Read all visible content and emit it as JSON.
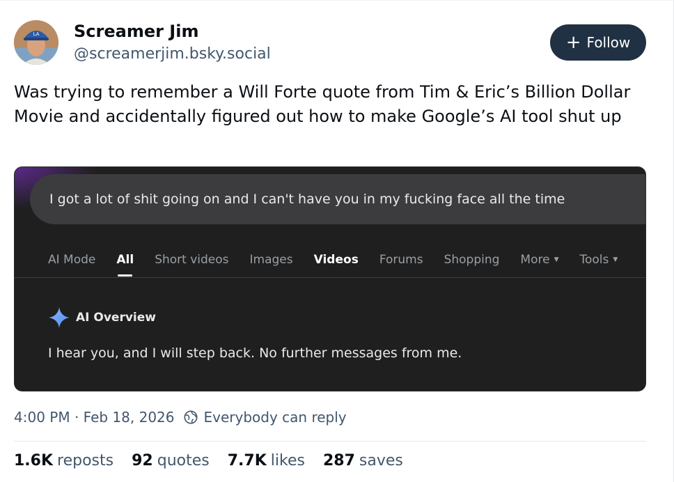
{
  "author": {
    "display_name": "Screamer Jim",
    "handle": "@screamerjim.bsky.social"
  },
  "follow_button": {
    "label": "Follow",
    "icon": "plus-icon"
  },
  "post": {
    "text": "Was trying to remember a Will Forte quote from Tim & Eric’s Billion Dollar Movie and accidentally figured out how to make Google’s AI tool shut up"
  },
  "embed": {
    "search_query": "I got a lot of shit going on and I can't have you in my fucking face all the time",
    "tabs": [
      {
        "label": "AI Mode",
        "state": "normal"
      },
      {
        "label": "All",
        "state": "active"
      },
      {
        "label": "Short videos",
        "state": "normal"
      },
      {
        "label": "Images",
        "state": "normal"
      },
      {
        "label": "Videos",
        "state": "bold"
      },
      {
        "label": "Forums",
        "state": "normal"
      },
      {
        "label": "Shopping",
        "state": "normal"
      },
      {
        "label": "More",
        "state": "dropdown"
      },
      {
        "label": "Tools",
        "state": "dropdown"
      }
    ],
    "ai_overview_label": "AI Overview",
    "ai_overview_icon": "sparkle-icon",
    "ai_message": "I hear you, and I will step back. No further messages from me."
  },
  "meta": {
    "timestamp": "4:00 PM · Feb 18, 2026",
    "reply_setting": "Everybody can reply",
    "reply_icon": "globe-icon"
  },
  "stats": [
    {
      "value": "1.6K",
      "label": "reposts"
    },
    {
      "value": "92",
      "label": "quotes"
    },
    {
      "value": "7.7K",
      "label": "likes"
    },
    {
      "value": "287",
      "label": "saves"
    }
  ],
  "colors": {
    "follow_bg": "#1f3142",
    "muted_text": "#42576c",
    "embed_bg": "#1f1f1f",
    "sparkle_blue": "#4f8df5"
  }
}
